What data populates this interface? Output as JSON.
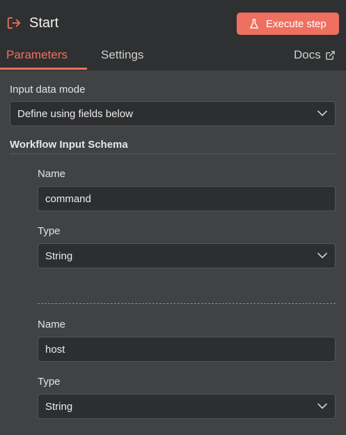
{
  "header": {
    "title": "Start",
    "execute_label": "Execute step",
    "accent": "#ef7060"
  },
  "tabs": {
    "parameters": "Parameters",
    "settings": "Settings",
    "docs": "Docs"
  },
  "input_mode": {
    "label": "Input data mode",
    "value": "Define using fields below"
  },
  "schema": {
    "title": "Workflow Input Schema",
    "fields": [
      {
        "name_label": "Name",
        "name_value": "command",
        "type_label": "Type",
        "type_value": "String"
      },
      {
        "name_label": "Name",
        "name_value": "host",
        "type_label": "Type",
        "type_value": "String"
      }
    ]
  },
  "icons": {
    "node": "sign-in-icon",
    "execute": "flask-icon",
    "docs": "external-link-icon",
    "select": "chevron-down-icon"
  }
}
